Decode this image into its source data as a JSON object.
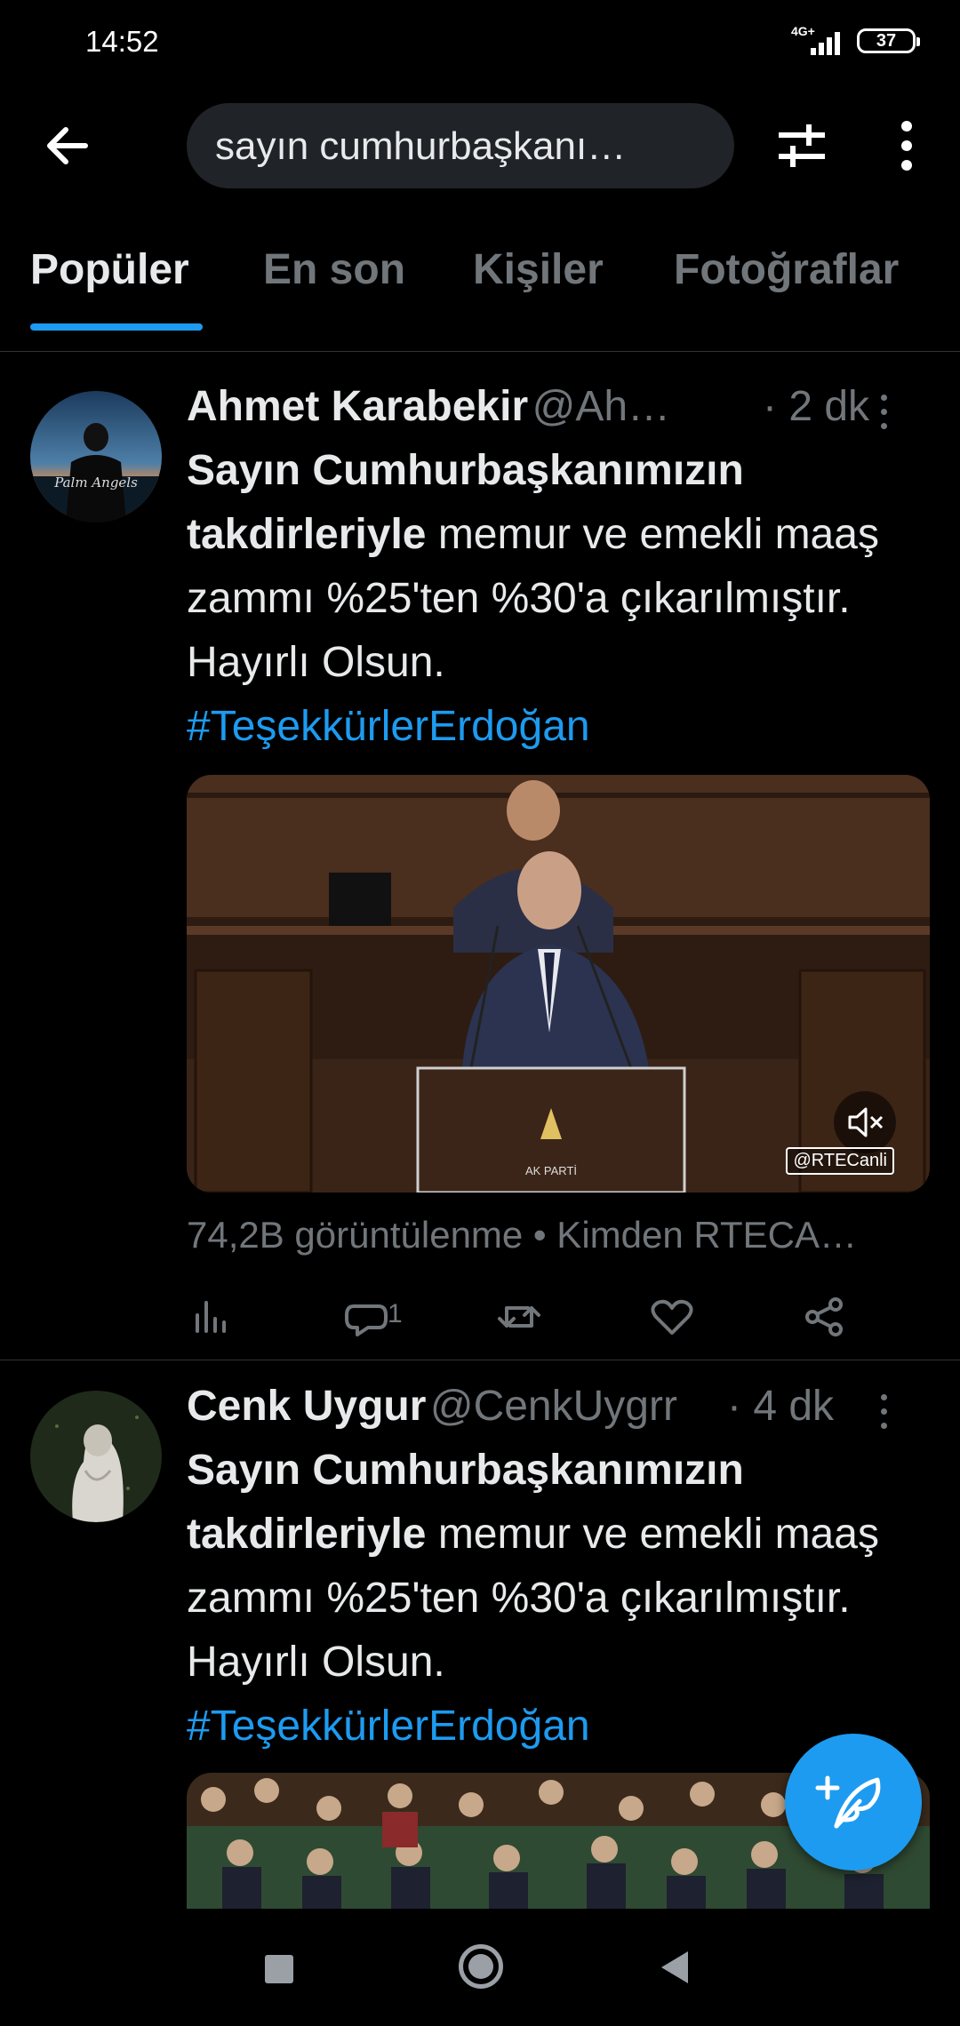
{
  "status_bar": {
    "time": "14:52",
    "network": "4G+",
    "battery": "37"
  },
  "header": {
    "search_value": "sayın cumhurbaşkanı…",
    "back_icon": "arrow-left-icon",
    "filter_icon": "sliders-icon",
    "more_icon": "vertical-dots-icon"
  },
  "tabs": [
    {
      "label": "Popüler",
      "active": true
    },
    {
      "label": "En son",
      "active": false
    },
    {
      "label": "Kişiler",
      "active": false
    },
    {
      "label": "Fotoğraflar",
      "active": false
    }
  ],
  "tweets": [
    {
      "name": "Ahmet Karabekir",
      "handle": "@Ah…",
      "time": "· 2 dk",
      "body_bold": "Sayın Cumhurbaşkanımızın takdirleriyle",
      "body_rest": " memur ve emekli maaş zammı %25'ten %30'a çıkarılmıştır. Hayırlı Olsun.",
      "hashtag": "#TeşekkürlerErdoğan",
      "media_watermark": "@RTECanli",
      "views": "74,2B görüntülenme • Kimden RTECA…",
      "reply_count": "1"
    },
    {
      "name": "Cenk Uygur",
      "handle": "@CenkUygrr",
      "time": "· 4 dk",
      "body_bold": "Sayın Cumhurbaşkanımızın takdirleriyle",
      "body_rest": " memur ve emekli maaş zammı %25'ten %30'a çıkarılmıştır. Hayırlı Olsun.",
      "hashtag": "#TeşekkürlerErdoğan"
    }
  ],
  "colors": {
    "accent": "#1d9bf0",
    "background": "#000000",
    "secondary_text": "#71767b"
  }
}
